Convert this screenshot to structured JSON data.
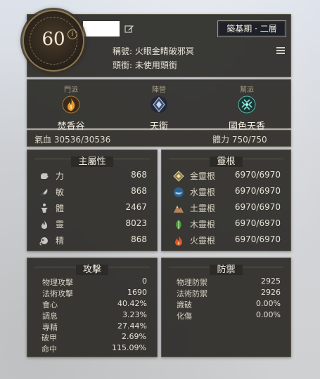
{
  "header": {
    "level": "60",
    "level_info_icon": "info-icon",
    "name_value": "",
    "realm": "築基期 · 二層",
    "title_label": "稱號:",
    "title_value": "火眼金睛破邪冥",
    "headgear_label": "頭銜:",
    "headgear_value": "未使用頭銜"
  },
  "affiliation": [
    {
      "caption": "門派",
      "name": "焚香谷",
      "icon": "flame-emblem-icon",
      "color": "#e0902a"
    },
    {
      "caption": "陣營",
      "name": "天衛",
      "icon": "diamond-emblem-icon",
      "color": "#8fa6c6"
    },
    {
      "caption": "幫派",
      "name": "國色天香",
      "icon": "jade-emblem-icon",
      "color": "#63c5b8"
    }
  ],
  "hp": {
    "label": "氣血",
    "value": "30536/30536"
  },
  "physique": {
    "label": "體力",
    "value": "750/750"
  },
  "main_attributes": {
    "title": "主屬性",
    "rows": [
      {
        "label": "力",
        "value": "868",
        "icon": "fist-icon"
      },
      {
        "label": "敏",
        "value": "868",
        "icon": "feather-icon"
      },
      {
        "label": "體",
        "value": "2467",
        "icon": "body-icon"
      },
      {
        "label": "靈",
        "value": "8023",
        "icon": "flame-icon"
      },
      {
        "label": "精",
        "value": "868",
        "icon": "spirit-icon"
      }
    ]
  },
  "spirit_roots": {
    "title": "靈根",
    "rows": [
      {
        "label": "金靈根",
        "value": "6970/6970",
        "icon": "metal-root-icon",
        "color": "#d8c784"
      },
      {
        "label": "水靈根",
        "value": "6970/6970",
        "icon": "water-root-icon",
        "color": "#6fa9d8"
      },
      {
        "label": "土靈根",
        "value": "6970/6970",
        "icon": "earth-root-icon",
        "color": "#c79a6a"
      },
      {
        "label": "木靈根",
        "value": "6970/6970",
        "icon": "wood-root-icon",
        "color": "#7cc36a"
      },
      {
        "label": "火靈根",
        "value": "6970/6970",
        "icon": "fire-root-icon",
        "color": "#e26a3c"
      }
    ]
  },
  "attack": {
    "title": "攻擊",
    "rows": [
      {
        "label": "物理攻擊",
        "value": "0"
      },
      {
        "label": "法術攻擊",
        "value": "1690"
      },
      {
        "label": "會心",
        "value": "40.42%"
      },
      {
        "label": "調息",
        "value": "3.23%"
      },
      {
        "label": "專精",
        "value": "27.44%"
      },
      {
        "label": "破甲",
        "value": "2.69%"
      },
      {
        "label": "命中",
        "value": "115.09%"
      }
    ]
  },
  "defense": {
    "title": "防禦",
    "rows": [
      {
        "label": "物理防禦",
        "value": "2925"
      },
      {
        "label": "法術防禦",
        "value": "2926"
      },
      {
        "label": "識破",
        "value": "0.00%"
      },
      {
        "label": "化傷",
        "value": "0.00%"
      }
    ]
  }
}
